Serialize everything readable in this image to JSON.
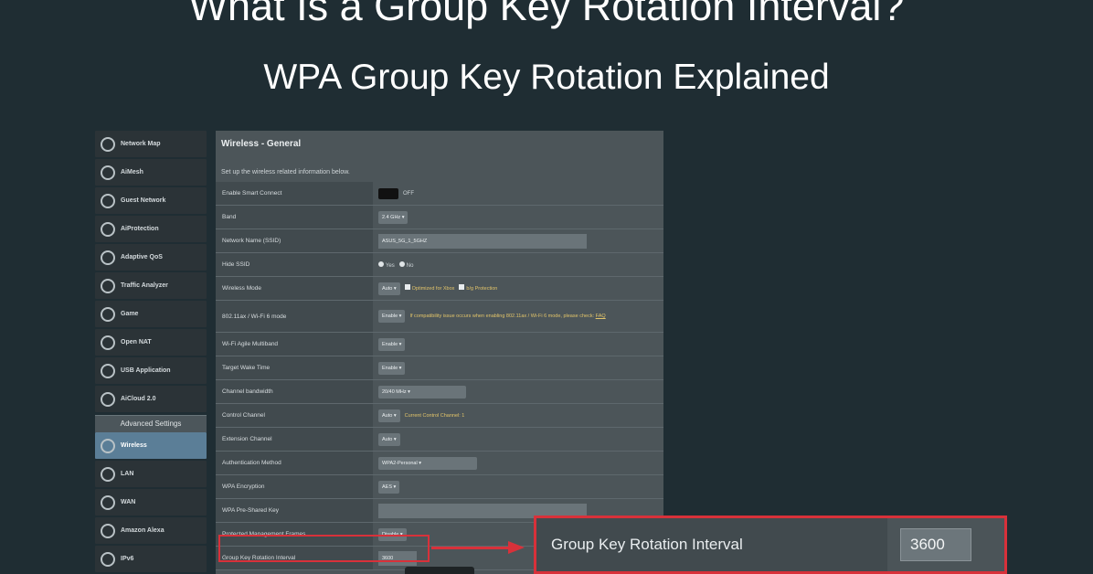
{
  "header": {
    "title": "What Is a Group Key Rotation Interval?",
    "subtitle": "WPA Group Key Rotation Explained"
  },
  "sidebar": {
    "items": [
      {
        "label": "Network Map",
        "icon": "network-map-icon"
      },
      {
        "label": "AiMesh",
        "icon": "aimesh-icon"
      },
      {
        "label": "Guest Network",
        "icon": "guest-network-icon"
      },
      {
        "label": "AiProtection",
        "icon": "shield-icon"
      },
      {
        "label": "Adaptive QoS",
        "icon": "gauge-icon"
      },
      {
        "label": "Traffic Analyzer",
        "icon": "chart-icon"
      },
      {
        "label": "Game",
        "icon": "gamepad-icon"
      },
      {
        "label": "Open NAT",
        "icon": "globe-icon"
      },
      {
        "label": "USB Application",
        "icon": "usb-icon"
      },
      {
        "label": "AiCloud 2.0",
        "icon": "cloud-icon"
      }
    ],
    "advanced_header": "Advanced Settings",
    "advanced_items": [
      {
        "label": "Wireless",
        "icon": "wifi-icon"
      },
      {
        "label": "LAN",
        "icon": "lan-icon"
      },
      {
        "label": "WAN",
        "icon": "globe-icon"
      },
      {
        "label": "Amazon Alexa",
        "icon": "alexa-icon"
      },
      {
        "label": "IPv6",
        "icon": "ipv6-icon"
      }
    ]
  },
  "panel": {
    "title": "Wireless - General",
    "description": "Set up the wireless related information below.",
    "rows": {
      "smart_connect": {
        "label": "Enable Smart Connect",
        "value": "OFF"
      },
      "band": {
        "label": "Band",
        "value": "2.4 GHz"
      },
      "ssid": {
        "label": "Network Name (SSID)",
        "value": "ASUS_5G_1_5GHZ"
      },
      "hide_ssid": {
        "label": "Hide SSID",
        "yes": "Yes",
        "no": "No"
      },
      "wireless_mode": {
        "label": "Wireless Mode",
        "value": "Auto",
        "opt1": "Optimized for Xbox",
        "opt2": "b/g Protection"
      },
      "ax_mode": {
        "label": "802.11ax / Wi-Fi 6 mode",
        "value": "Enable",
        "note": "If compatibility issue occurs when enabling 802.11ax / Wi-Fi 6 mode, please check:",
        "faq": "FAQ"
      },
      "multiuser": {
        "label": "Wi-Fi Agile Multiband",
        "value": "Enable"
      },
      "twt": {
        "label": "Target Wake Time",
        "value": "Enable"
      },
      "bandwidth": {
        "label": "Channel bandwidth",
        "value": "20/40 MHz"
      },
      "control_channel": {
        "label": "Control Channel",
        "value": "Auto",
        "note": "Current Control Channel: 1"
      },
      "ext_channel": {
        "label": "Extension Channel",
        "value": "Auto"
      },
      "auth": {
        "label": "Authentication Method",
        "value": "WPA2-Personal"
      },
      "encryption": {
        "label": "WPA Encryption",
        "value": "AES"
      },
      "psk": {
        "label": "WPA Pre-Shared Key",
        "value": ""
      },
      "pmf": {
        "label": "Protected Management Frames",
        "value": "Disable"
      },
      "gkri": {
        "label": "Group Key Rotation Interval",
        "value": "3600"
      }
    }
  },
  "callout": {
    "label": "Group Key Rotation Interval",
    "value": "3600"
  },
  "colors": {
    "background": "#1f2d33",
    "highlight": "#d8313a",
    "note": "#e2c46a"
  }
}
